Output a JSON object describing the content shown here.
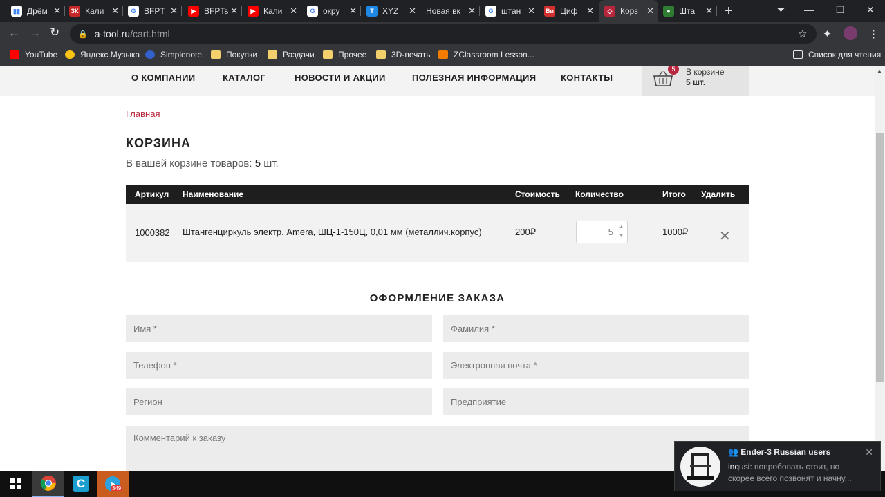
{
  "browser": {
    "tabs": [
      {
        "label": "Дрём",
        "icon_color": "#ffffff",
        "icon_text": "▮▮"
      },
      {
        "label": "Кали",
        "icon_color": "#c62828",
        "icon_text": "ЗК"
      },
      {
        "label": "BFPT",
        "icon_color": "#ffffff",
        "icon_text": "G"
      },
      {
        "label": "BFPTs",
        "icon_color": "#ff0000",
        "icon_text": "▶"
      },
      {
        "label": "Кали",
        "icon_color": "#ff0000",
        "icon_text": "▶"
      },
      {
        "label": "окру",
        "icon_color": "#ffffff",
        "icon_text": "G"
      },
      {
        "label": "XYZ",
        "icon_color": "#1e88e5",
        "icon_text": "T"
      },
      {
        "label": "Новая вк",
        "icon_color": "",
        "icon_text": ""
      },
      {
        "label": "штан",
        "icon_color": "#ffffff",
        "icon_text": "G"
      },
      {
        "label": "Циф",
        "icon_color": "#d32f2f",
        "icon_text": "Ви"
      },
      {
        "label": "Корз",
        "icon_color": "#b8263e",
        "icon_text": "◇"
      },
      {
        "label": "Шта",
        "icon_color": "#2e7d32",
        "icon_text": "●"
      }
    ],
    "url_host": "a-tool.ru",
    "url_path": "/cart.html",
    "bookmarks": [
      "YouTube",
      "Яндекс.Музыка",
      "Simplenote",
      "Покупки",
      "Раздачи",
      "Прочее",
      "3D-печать",
      "ZClassroom Lesson..."
    ],
    "reading_list": "Список для чтения"
  },
  "site": {
    "menu": [
      "О КОМПАНИИ",
      "КАТАЛОГ",
      "НОВОСТИ И АКЦИИ",
      "ПОЛЕЗНАЯ ИНФОРМАЦИЯ",
      "КОНТАКТЫ"
    ],
    "cart": {
      "badge": "5",
      "line1": "В корзине",
      "line2": "5 шт."
    },
    "breadcrumb": "Главная",
    "title": "КОРЗИНА",
    "summary_prefix": "В вашей корзине товаров: ",
    "summary_count": "5",
    "summary_suffix": " шт.",
    "table": {
      "headers": [
        "Артикул",
        "Наименование",
        "Стоимость",
        "Количество",
        "Итого",
        "Удалить"
      ],
      "rows": [
        {
          "sku": "1000382",
          "name": "Штангенциркуль электр. Amera, ШЦ-1-150Ц, 0,01 мм (металлич.корпус)",
          "price": "200₽",
          "qty": "5",
          "total": "1000₽"
        }
      ]
    },
    "order_title": "ОФОРМЛЕНИЕ ЗАКАЗА",
    "form": {
      "first_name": "Имя *",
      "last_name": "Фамилия *",
      "phone": "Телефон *",
      "email": "Электронная почта *",
      "region": "Регион",
      "company": "Предприятие",
      "comment": "Комментарий к заказу"
    }
  },
  "notification": {
    "title": "Ender-3 Russian users",
    "sender": "inqusi:",
    "text": " попробовать стоит, но скорее всего позвонят и начну..."
  },
  "taskbar": {
    "telegram_badge": "349"
  }
}
